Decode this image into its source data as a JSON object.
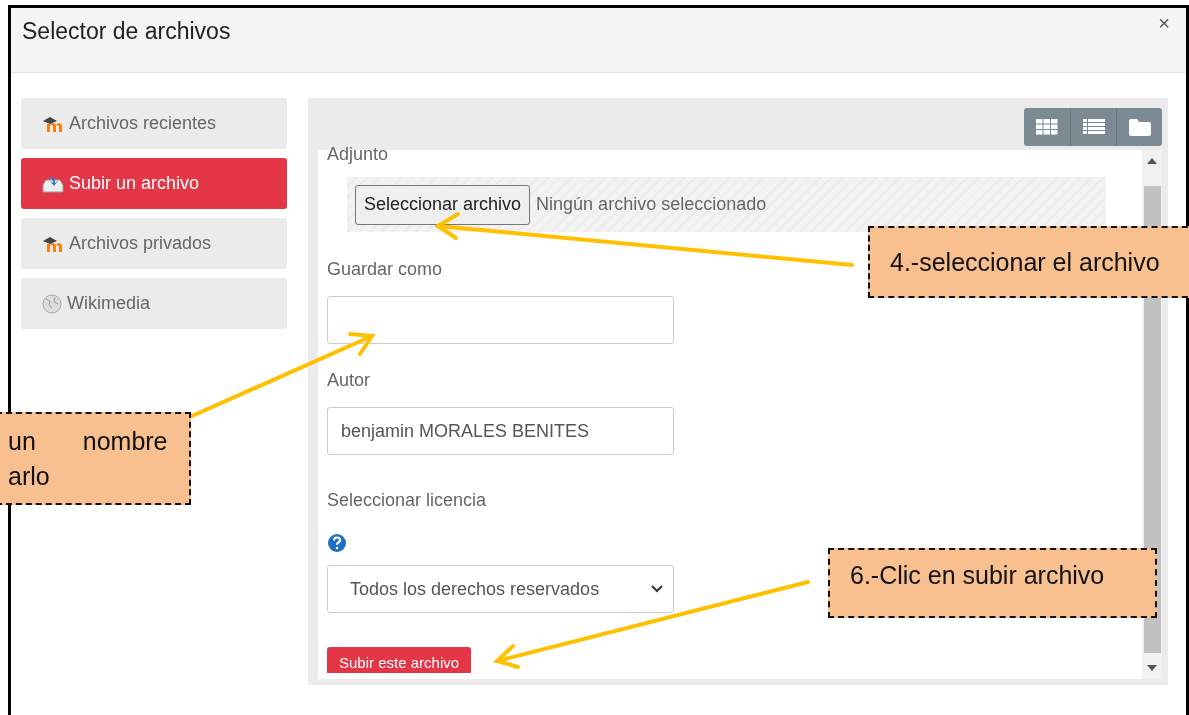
{
  "dialog": {
    "title": "Selector de archivos",
    "close": "×"
  },
  "sidebar": {
    "items": [
      {
        "label": "Archivos recientes",
        "kind": "moodle",
        "selected": false
      },
      {
        "label": "Subir un archivo",
        "kind": "upload",
        "selected": true
      },
      {
        "label": "Archivos privados",
        "kind": "moodle",
        "selected": false
      },
      {
        "label": "Wikimedia",
        "kind": "globe",
        "selected": false
      }
    ]
  },
  "view_buttons": [
    {
      "kind": "grid"
    },
    {
      "kind": "list"
    },
    {
      "kind": "folder"
    }
  ],
  "form": {
    "attachment_label": "Adjunto",
    "file_button": "Seleccionar archivo",
    "file_status": "Ningún archivo seleccionado",
    "save_as_label": "Guardar como",
    "author_label": "Autor",
    "author_value": "benjamin MORALES BENITES",
    "license_label": "Seleccionar licencia",
    "license_value": "Todos los derechos reservados",
    "submit": "Subir este archivo"
  },
  "callouts": [
    {
      "kind": "step4",
      "lines": [
        "4.-seleccionar el archivo"
      ]
    },
    {
      "kind": "step5",
      "lines": [
        "un nombre",
        "arlo"
      ]
    },
    {
      "kind": "step6",
      "lines": [
        "6.-Clic en subir archivo"
      ]
    }
  ]
}
